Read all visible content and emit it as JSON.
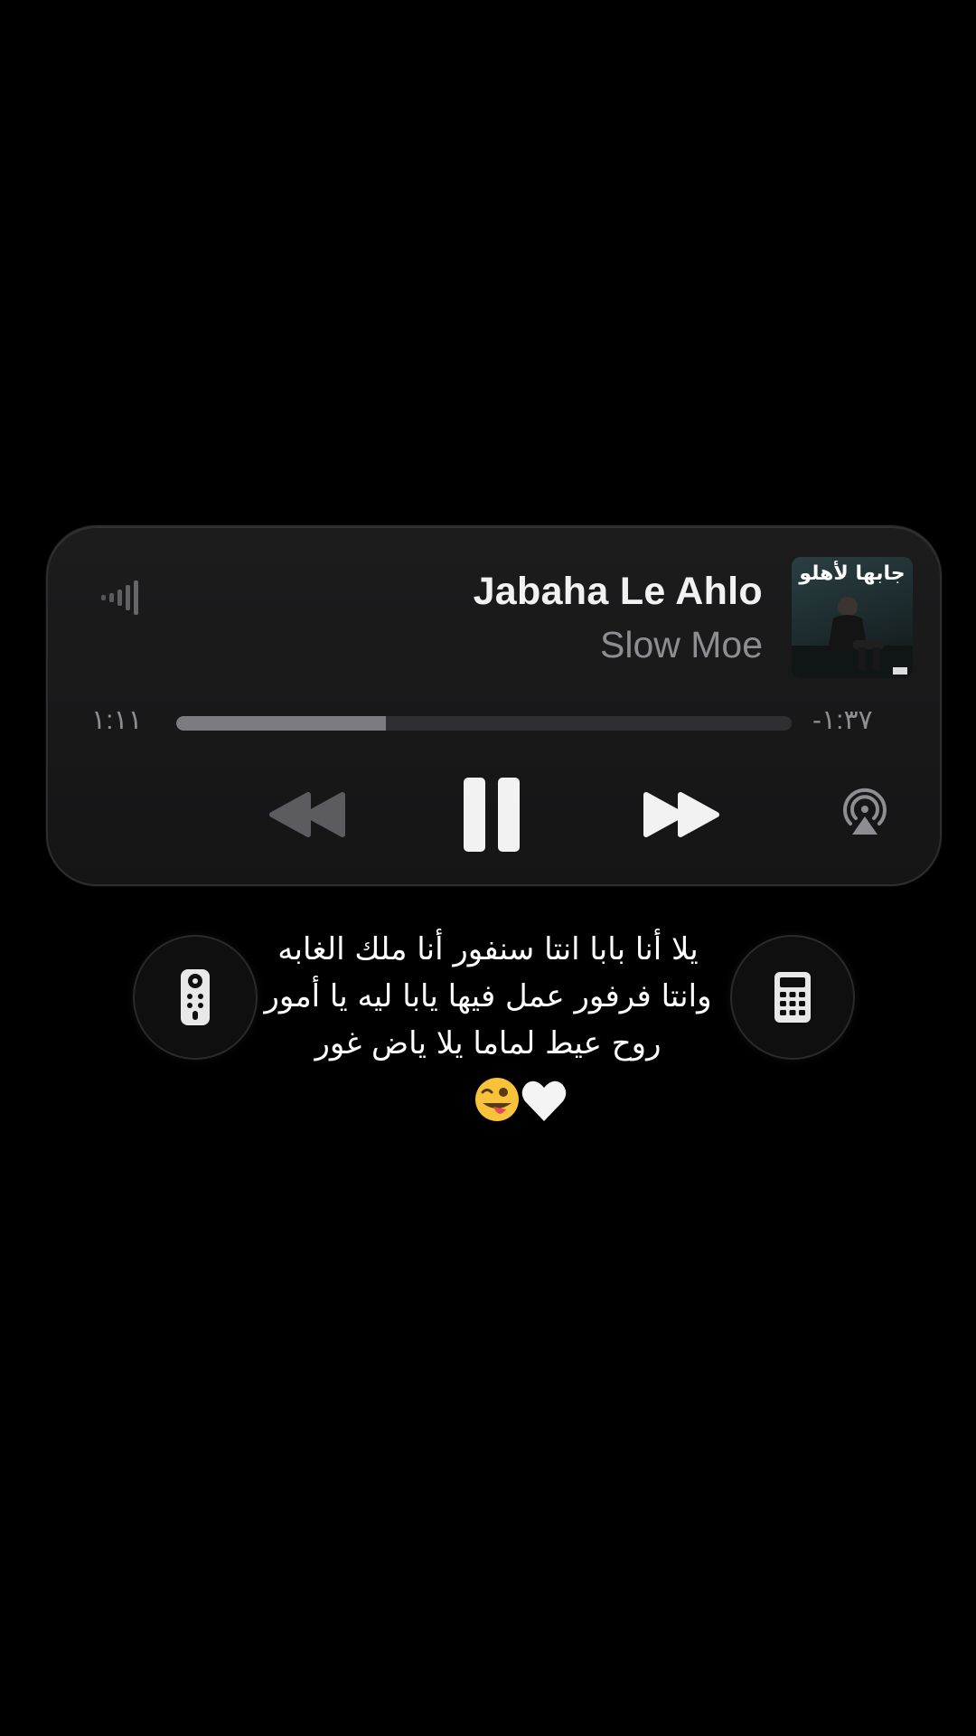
{
  "now_playing": {
    "title": "Jabaha Le Ahlo",
    "artist": "Slow Moe",
    "album_art_text": "جابها لأهلو",
    "time_elapsed": "١:١١",
    "time_remaining": "-١:٣٧",
    "progress": 0.34
  },
  "controls": {
    "rewind": "rewind-icon",
    "pause": "pause-icon",
    "forward": "fast-forward-icon",
    "airplay": "airplay-icon",
    "signal": "signal-bars-icon"
  },
  "side_buttons": {
    "left": "remote-icon",
    "right": "calculator-icon"
  },
  "lyrics": {
    "line1": "يلا أنا بابا انتا سنفور أنا ملك الغابه",
    "line2": "وانتا فرفور عمل فيها يابا ليه يا أمور",
    "line3": "روح عيط لماما يلا ياض غور",
    "emoji_icons": [
      "winking-face-with-tongue-icon",
      "white-heart-icon"
    ]
  },
  "colors": {
    "background": "#000000",
    "widget": "#1a1a1b",
    "primary_text": "#f2f2f2",
    "secondary_text": "#8e8e92",
    "progress_fill": "#7c7c80",
    "progress_track": "#2f2f32"
  }
}
